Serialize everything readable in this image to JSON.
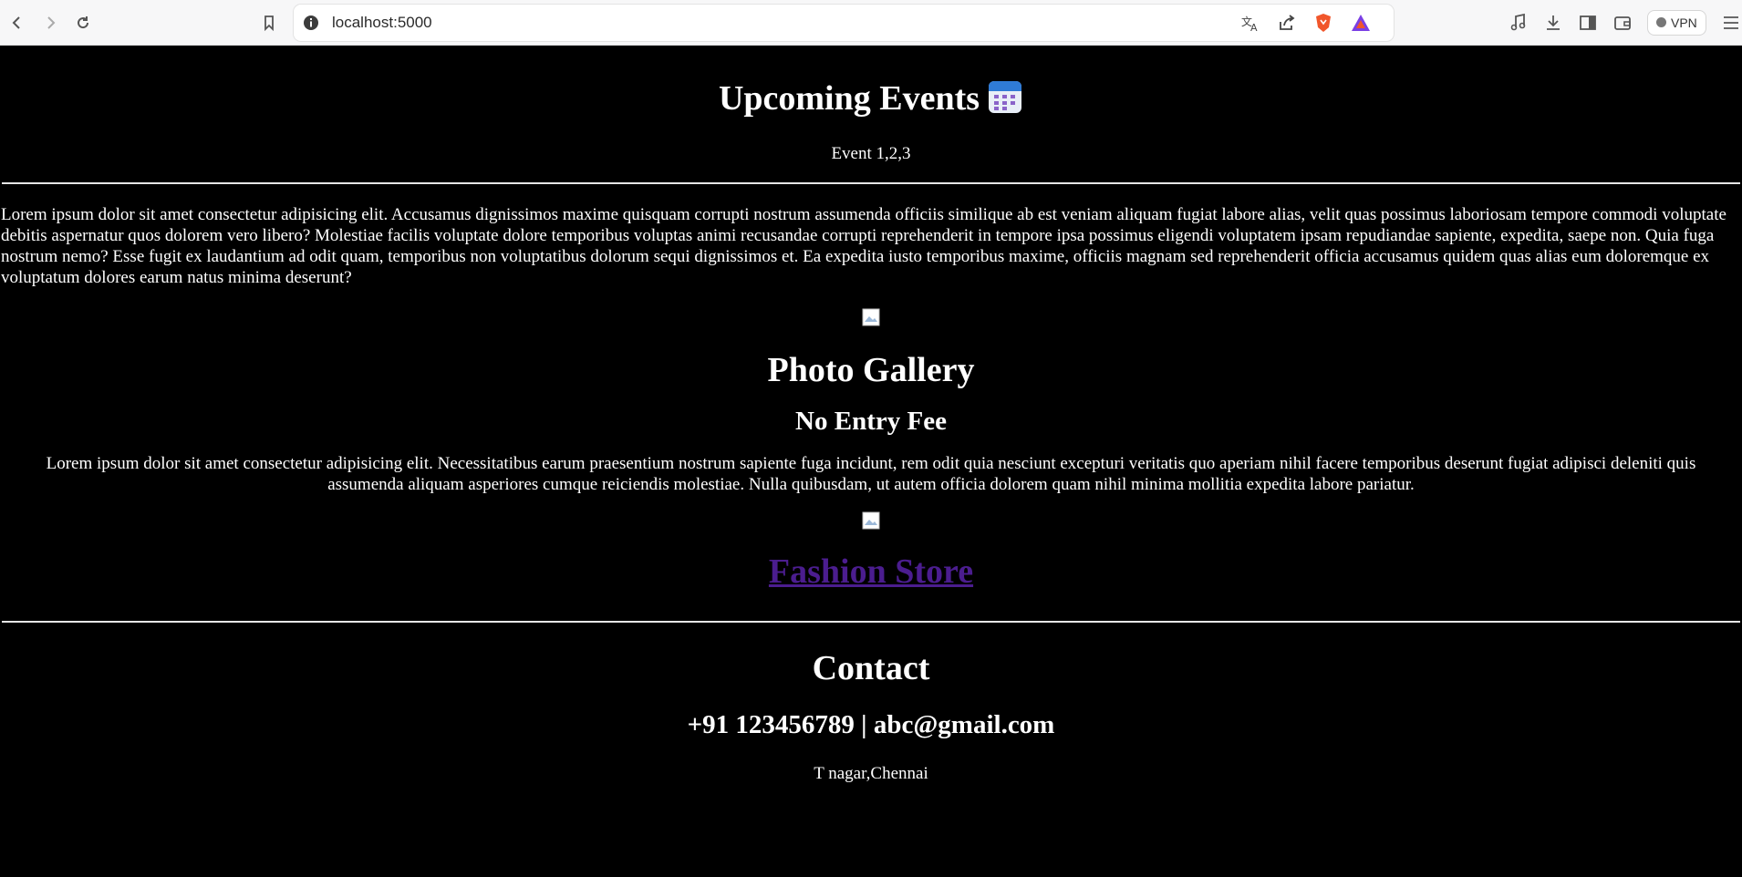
{
  "browser": {
    "url": "localhost:5000",
    "vpn_label": "VPN"
  },
  "header": {
    "title": "Upcoming Events",
    "subtitle": "Event 1,2,3"
  },
  "intro": {
    "paragraph": "Lorem ipsum dolor sit amet consectetur adipisicing elit. Accusamus dignissimos maxime quisquam corrupti nostrum assumenda officiis similique ab est veniam aliquam fugiat labore alias, velit quas possimus laboriosam tempore commodi voluptate debitis aspernatur quos dolorem vero libero? Molestiae facilis voluptate dolore temporibus voluptas animi recusandae corrupti reprehenderit in tempore ipsa possimus eligendi voluptatem ipsam repudiandae sapiente, expedita, saepe non. Quia fuga nostrum nemo? Esse fugit ex laudantium ad odit quam, temporibus non voluptatibus dolorum sequi dignissimos et. Ea expedita iusto temporibus maxime, officiis magnam sed reprehenderit officia accusamus quidem quas alias eum doloremque ex voluptatum dolores earum natus minima deserunt?"
  },
  "gallery": {
    "title": "Photo Gallery",
    "fee": "No Entry Fee",
    "paragraph": "Lorem ipsum dolor sit amet consectetur adipisicing elit. Necessitatibus earum praesentium nostrum sapiente fuga incidunt, rem odit quia nesciunt excepturi veritatis quo aperiam nihil facere temporibus deserunt fugiat adipisci deleniti quis assumenda aliquam asperiores cumque reiciendis molestiae. Nulla quibusdam, ut autem officia dolorem quam nihil minima mollitia expedita labore pariatur.",
    "store_link": "Fashion Store"
  },
  "contact": {
    "title": "Contact",
    "line": "+91 123456789 | abc@gmail.com",
    "address": "T nagar,Chennai"
  },
  "colors": {
    "background": "#000000",
    "text": "#ffffff",
    "link": "#4b1d8f"
  }
}
